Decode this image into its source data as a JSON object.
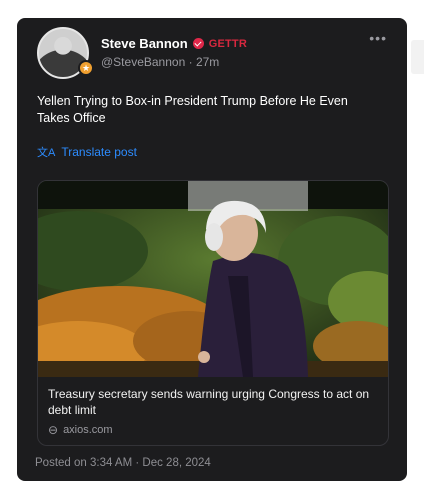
{
  "author": {
    "name": "Steve Bannon",
    "platform": "GETTR",
    "handle": "@SteveBannon",
    "separator": "·",
    "age": "27m"
  },
  "post": {
    "text": "Yellen Trying to Box-in President Trump Before He Even Takes Office",
    "translate_label": "Translate post"
  },
  "link_preview": {
    "title": "Treasury secretary sends warning urging Congress to act on debt limit",
    "domain": "axios.com"
  },
  "posted_at": "Posted on 3:34 AM · Dec 28, 2024",
  "icons": {
    "verified": "verified-badge-icon",
    "more": "more-options-icon",
    "translate": "translate-icon",
    "link": "link-icon"
  },
  "colors": {
    "card_bg": "#1c1c1e",
    "accent_blue": "#2d8cff",
    "brand_red": "#d8283f"
  }
}
